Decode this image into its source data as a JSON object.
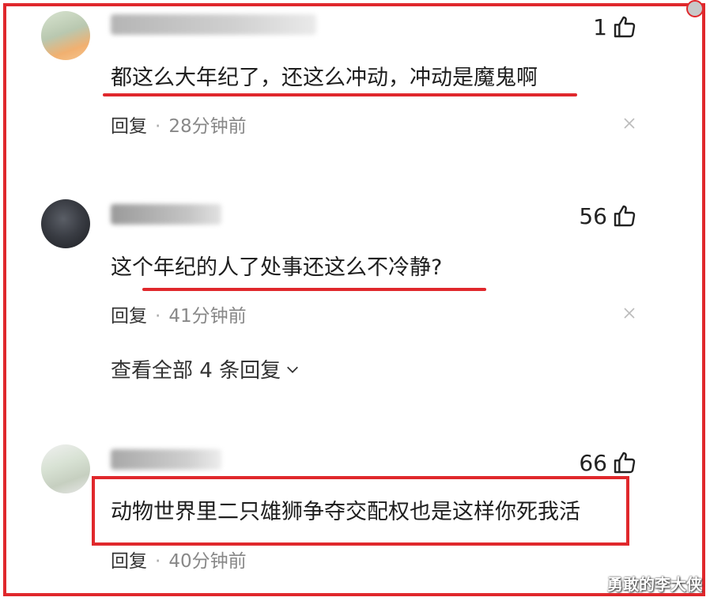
{
  "comments": [
    {
      "likes": "1",
      "text": "都这么大年纪了，还这么冲动，冲动是魔鬼啊",
      "reply_label": "回复",
      "time": "28分钟前"
    },
    {
      "likes": "56",
      "text": "这个年纪的人了处事还这么不冷静?",
      "reply_label": "回复",
      "time": "41分钟前",
      "view_all_replies": "查看全部 4 条回复"
    },
    {
      "likes": "66",
      "text": "动物世界里二只雄狮争夺交配权也是这样你死我活",
      "reply_label": "回复",
      "time": "40分钟前"
    }
  ],
  "separator": "·",
  "watermark": "勇敢的李大侠",
  "colors": {
    "highlight_red": "#e0282c",
    "time_gray": "#888888"
  },
  "icons": [
    "thumbs-up-icon",
    "close-icon",
    "chevron-down-icon"
  ]
}
